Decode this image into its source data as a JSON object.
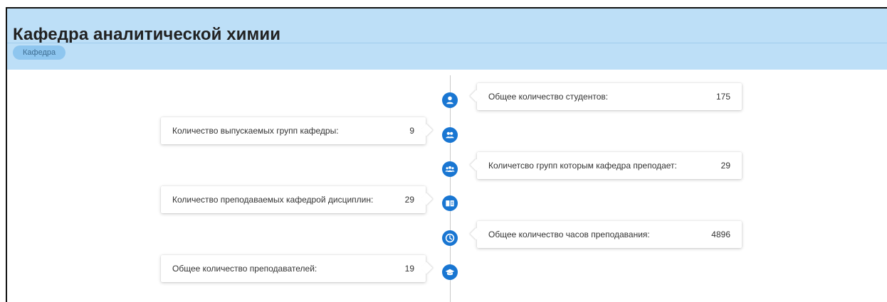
{
  "header": {
    "title": "Кафедра аналитической химии",
    "breadcrumb": "Кафедра"
  },
  "colors": {
    "header_bg": "#bddff7",
    "crumb_bg": "#8ec6ef",
    "node": "#1976d2"
  },
  "timeline": [
    {
      "label": "Общее количество студентов:",
      "value": "175",
      "icon": "person-icon"
    },
    {
      "label": "Количество выпускаемых групп кафедры:",
      "value": "9",
      "icon": "people-icon"
    },
    {
      "label": "Количетсво групп которым кафедра преподает:",
      "value": "29",
      "icon": "groups-icon"
    },
    {
      "label": "Количество преподаваемых кафедрой дисциплин:",
      "value": "29",
      "icon": "book-icon"
    },
    {
      "label": "Общее количество часов преподавания:",
      "value": "4896",
      "icon": "clock-icon"
    },
    {
      "label": "Общее количество преподавателей:",
      "value": "19",
      "icon": "graduation-cap-icon"
    }
  ]
}
